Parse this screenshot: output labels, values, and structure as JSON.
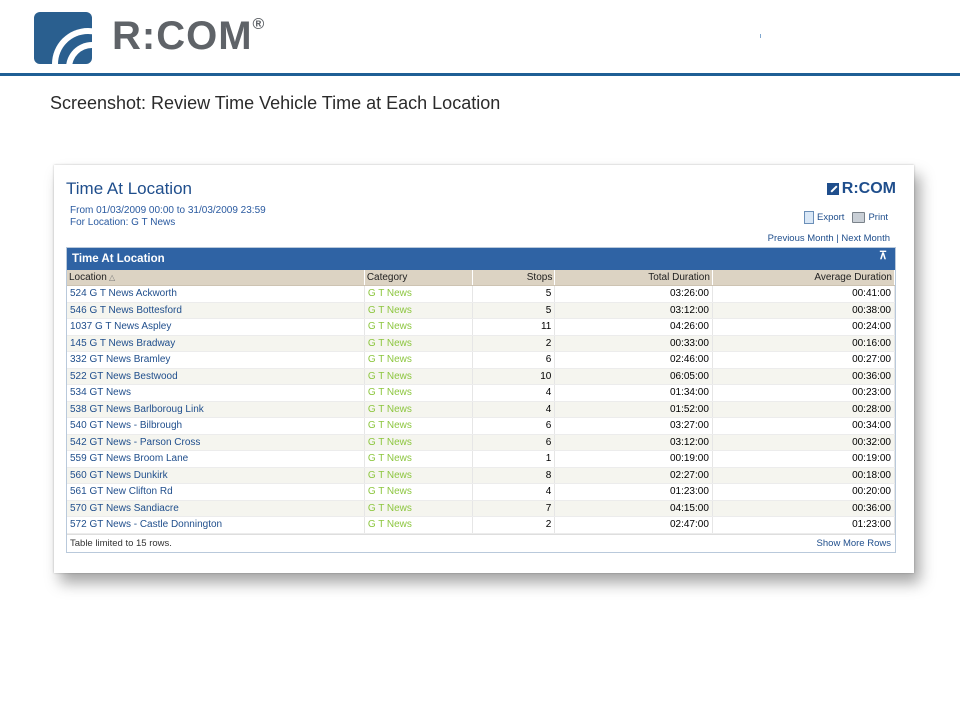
{
  "slide": {
    "brand": "R:COM",
    "brand_mark": "®",
    "caption": "Screenshot: Review Time Vehicle Time at Each Location"
  },
  "report": {
    "title": "Time At Location",
    "date_range": "From 01/03/2009 00:00 to 31/03/2009 23:59",
    "for_location": "For Location: G T News",
    "logo": "R:COM",
    "export_label": "Export",
    "print_label": "Print",
    "previous_month": "Previous Month",
    "separator": "|",
    "next_month": "Next Month",
    "table_title": "Time At Location",
    "columns": [
      "Location",
      "Category",
      "Stops",
      "Total Duration",
      "Average Duration"
    ],
    "rows": [
      {
        "location": "524 G T News Ackworth",
        "category": "G T News",
        "stops": "5",
        "total": "03:26:00",
        "average": "00:41:00"
      },
      {
        "location": "546 G T News Bottesford",
        "category": "G T News",
        "stops": "5",
        "total": "03:12:00",
        "average": "00:38:00"
      },
      {
        "location": "1037 G T News Aspley",
        "category": "G T News",
        "stops": "11",
        "total": "04:26:00",
        "average": "00:24:00"
      },
      {
        "location": "145 G T News Bradway",
        "category": "G T News",
        "stops": "2",
        "total": "00:33:00",
        "average": "00:16:00"
      },
      {
        "location": "332 GT News Bramley",
        "category": "G T News",
        "stops": "6",
        "total": "02:46:00",
        "average": "00:27:00"
      },
      {
        "location": "522 GT News Bestwood",
        "category": "G T News",
        "stops": "10",
        "total": "06:05:00",
        "average": "00:36:00"
      },
      {
        "location": "534 GT News",
        "category": "G T News",
        "stops": "4",
        "total": "01:34:00",
        "average": "00:23:00"
      },
      {
        "location": "538 GT News Barlboroug Link",
        "category": "G T News",
        "stops": "4",
        "total": "01:52:00",
        "average": "00:28:00"
      },
      {
        "location": "540 GT News - Bilbrough",
        "category": "G T News",
        "stops": "6",
        "total": "03:27:00",
        "average": "00:34:00"
      },
      {
        "location": "542 GT News - Parson Cross",
        "category": "G T News",
        "stops": "6",
        "total": "03:12:00",
        "average": "00:32:00"
      },
      {
        "location": "559 GT News Broom Lane",
        "category": "G T News",
        "stops": "1",
        "total": "00:19:00",
        "average": "00:19:00"
      },
      {
        "location": "560 GT News Dunkirk",
        "category": "G T News",
        "stops": "8",
        "total": "02:27:00",
        "average": "00:18:00"
      },
      {
        "location": "561 GT New Clifton Rd",
        "category": "G T News",
        "stops": "4",
        "total": "01:23:00",
        "average": "00:20:00"
      },
      {
        "location": "570 GT News Sandiacre",
        "category": "G T News",
        "stops": "7",
        "total": "04:15:00",
        "average": "00:36:00"
      },
      {
        "location": "572 GT News - Castle Donnington",
        "category": "G T News",
        "stops": "2",
        "total": "02:47:00",
        "average": "01:23:00"
      }
    ],
    "footer_note": "Table limited to 15 rows.",
    "show_more": "Show More Rows"
  },
  "colors": {
    "brand_blue": "#1f4e8c",
    "header_bar": "#2f63a4",
    "category_green": "#8cc63e",
    "column_header": "#dcd3c3"
  }
}
